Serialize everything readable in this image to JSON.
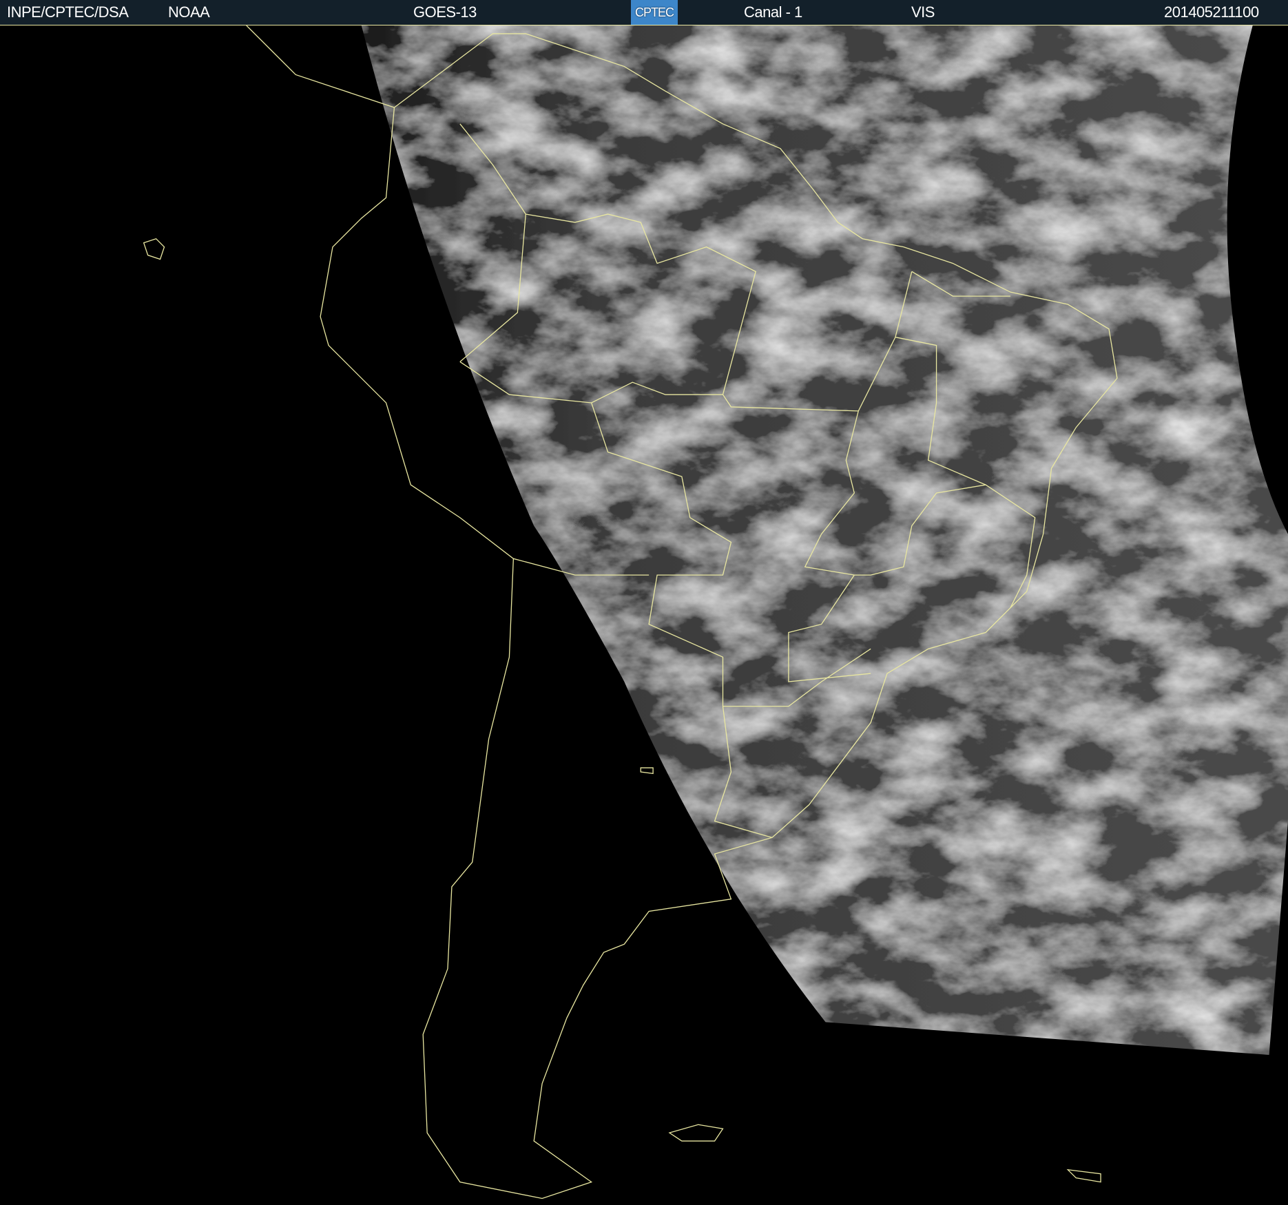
{
  "header": {
    "institution": "INPE/CPTEC/DSA",
    "agency": "NOAA",
    "satellite": "GOES-13",
    "logo_text": "CPTEC",
    "channel": "Canal - 1",
    "band": "VIS",
    "timestamp": "201405211100"
  },
  "colors": {
    "header_bg": "#13202a",
    "coastline": "#e8e6a0",
    "logo_bg": "#3d86c9"
  }
}
